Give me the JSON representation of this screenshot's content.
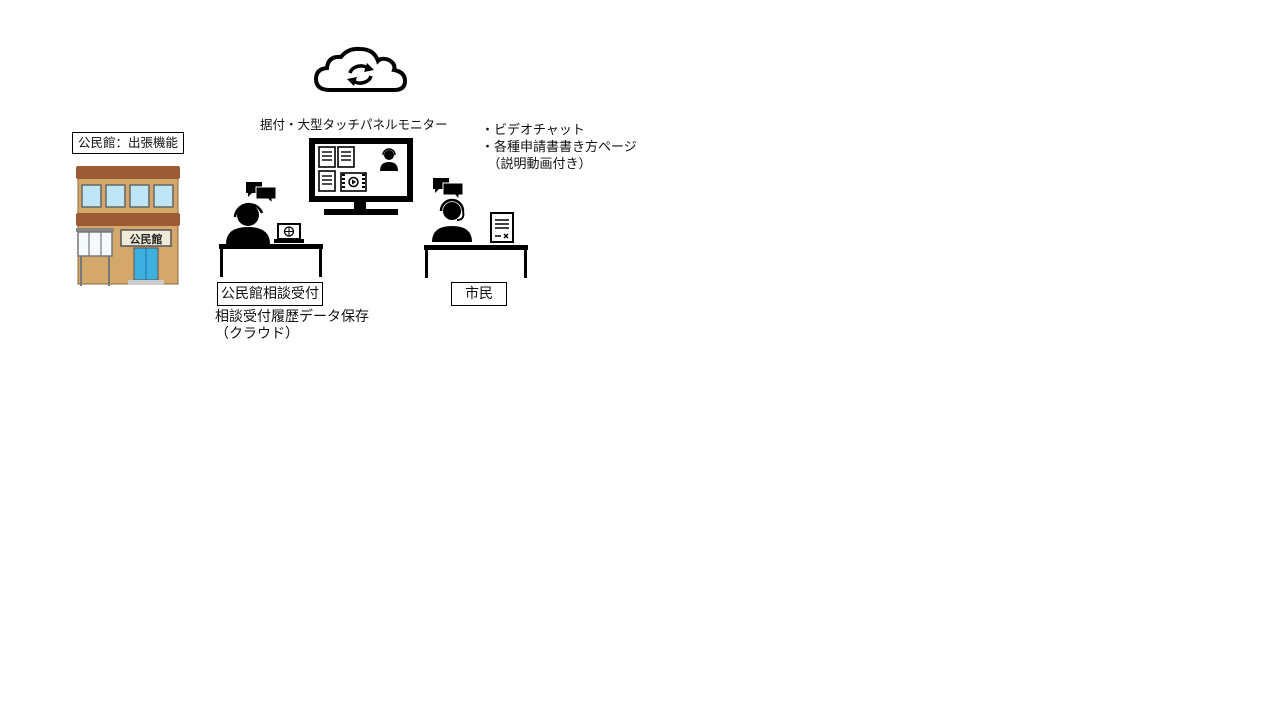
{
  "labels": {
    "kominkan_branch": "公民館：出張機能",
    "building_sign": "公民館",
    "monitor_caption": "据付・大型タッチパネルモニター",
    "features": [
      "・ビデオチャット",
      "・各種申請書書き方ページ",
      "　（説明動画付き）"
    ],
    "staff_box": "公民館相談受付",
    "citizen_box": "市民",
    "storage_lines": [
      "相談受付履歴データ保存",
      "（クラウド）"
    ]
  },
  "icons": {
    "cloud": "cloud-sync-icon",
    "building": "community-center-building-icon",
    "monitor": "touch-panel-monitor-icon",
    "staff": "operator-headset-icon",
    "citizen": "person-headset-icon",
    "laptop": "laptop-icon",
    "document": "document-form-icon"
  },
  "colors": {
    "building_wall": "#d3a86a",
    "building_roof": "#9c5b34",
    "window": "#bfe6f7",
    "door": "#3db0e0"
  }
}
